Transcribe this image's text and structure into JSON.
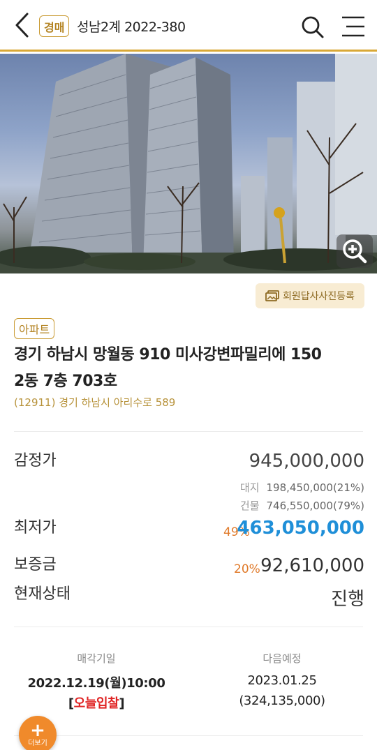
{
  "header": {
    "badge": "경매",
    "case_number": "성남2계 2022-380"
  },
  "photo": {
    "register_button": "회원답사사진등록"
  },
  "property": {
    "type": "아파트",
    "address_line1": "경기 하남시 망월동 910 미사강변파밀리에 150",
    "address_line2": "2동 7층 703호",
    "road_address": "(12911) 경기 하남시  아리수로  589"
  },
  "price": {
    "appraisal_label": "감정가",
    "appraisal_value": "945,000,000",
    "land_label": "대지",
    "land_value": "198,450,000(21%)",
    "building_label": "건물",
    "building_value": "746,550,000(79%)",
    "minimum_label": "최저가",
    "minimum_percent": "49%",
    "minimum_value": "463,050,000",
    "deposit_label": "보증금",
    "deposit_percent": "20%",
    "deposit_value": "92,610,000",
    "status_label": "현재상태",
    "status_value": "진행"
  },
  "schedule": {
    "sale_date_label": "매각기일",
    "sale_date_value": "2022.12.19(월)10:00",
    "today_bracket_open": "[",
    "today_text": "오늘입찰",
    "today_bracket_close": "]",
    "next_label": "다음예정",
    "next_date": "2023.01.25",
    "next_price": "(324,135,000)"
  },
  "fab": {
    "icon": "+",
    "label": "더보기"
  },
  "colors": {
    "accent_gold": "#d9a836",
    "min_price_blue": "#1f8fd8",
    "percent_orange": "#e07a2a",
    "today_red": "#e02424",
    "fab_orange": "#f08a2b"
  }
}
